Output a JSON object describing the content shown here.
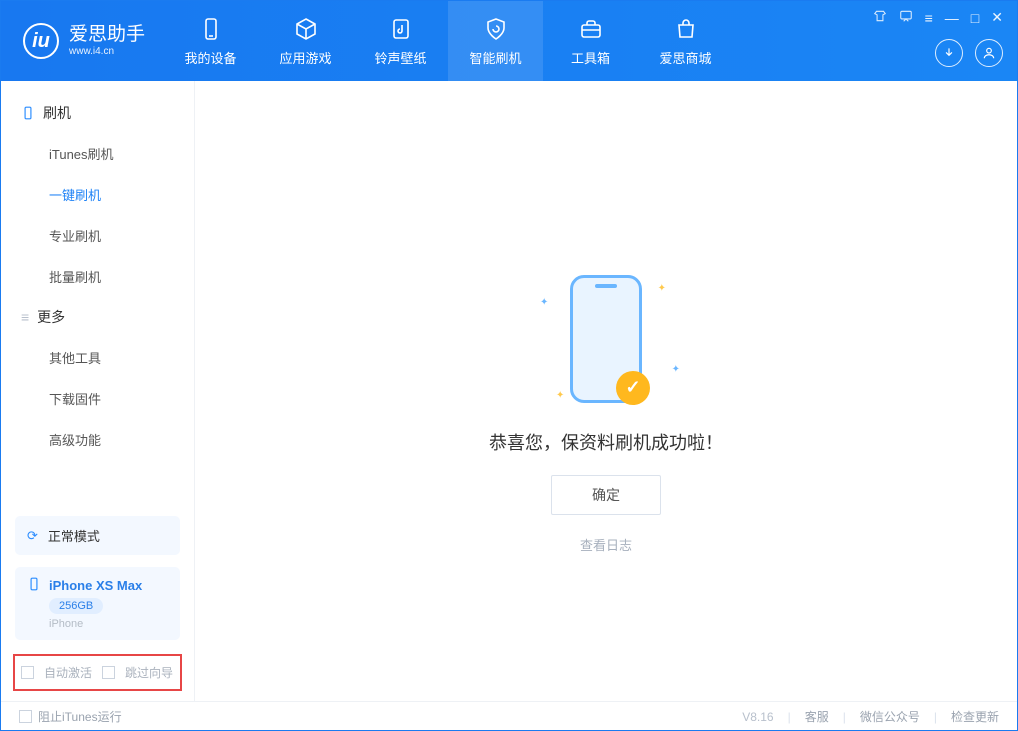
{
  "app": {
    "title": "爱思助手",
    "subtitle": "www.i4.cn"
  },
  "tabs": [
    {
      "label": "我的设备"
    },
    {
      "label": "应用游戏"
    },
    {
      "label": "铃声壁纸"
    },
    {
      "label": "智能刷机"
    },
    {
      "label": "工具箱"
    },
    {
      "label": "爱思商城"
    }
  ],
  "sidebar": {
    "group1": {
      "title": "刷机",
      "items": [
        "iTunes刷机",
        "一键刷机",
        "专业刷机",
        "批量刷机"
      ]
    },
    "group2": {
      "title": "更多",
      "items": [
        "其他工具",
        "下载固件",
        "高级功能"
      ]
    },
    "mode_label": "正常模式",
    "device": {
      "name": "iPhone XS Max",
      "storage": "256GB",
      "type": "iPhone"
    },
    "checks": {
      "auto_activate": "自动激活",
      "skip_guide": "跳过向导"
    }
  },
  "main": {
    "success_text": "恭喜您，保资料刷机成功啦！",
    "ok_label": "确定",
    "log_label": "查看日志"
  },
  "statusbar": {
    "block_itunes": "阻止iTunes运行",
    "version": "V8.16",
    "customer_service": "客服",
    "wechat": "微信公众号",
    "check_update": "检查更新"
  }
}
